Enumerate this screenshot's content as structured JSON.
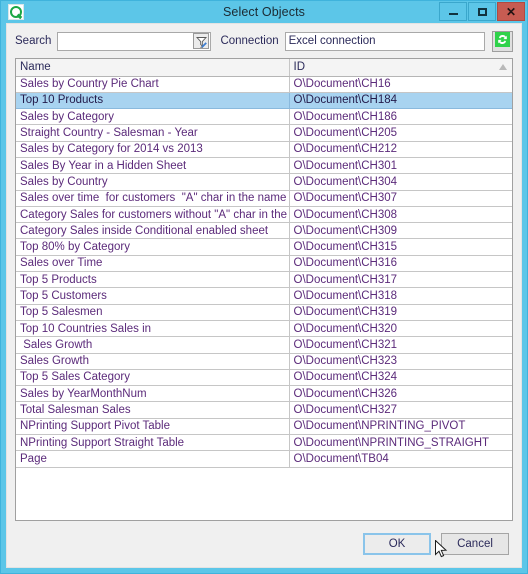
{
  "window": {
    "title": "Select Objects",
    "app_icon": "qlik-icon",
    "controls": {
      "minimize": "minimize-icon",
      "maximize": "maximize-icon",
      "close": "✕"
    }
  },
  "toolbar": {
    "search_label": "Search",
    "search_value": "",
    "search_placeholder": "",
    "filter_icon": "filter-pencil-icon",
    "connection_label": "Connection",
    "connection_value": "Excel connection",
    "refresh_icon": "refresh-icon"
  },
  "table": {
    "columns": [
      "Name",
      "ID"
    ],
    "sort_indicator": "ascending",
    "selected_row_index": 1,
    "rows": [
      {
        "name": "Sales by Country Pie Chart",
        "id": "O\\Document\\CH16"
      },
      {
        "name": "Top 10 Products",
        "id": "O\\Document\\CH184"
      },
      {
        "name": "Sales by Category",
        "id": "O\\Document\\CH186"
      },
      {
        "name": "Straight Country - Salesman - Year",
        "id": "O\\Document\\CH205"
      },
      {
        "name": "Sales by Category for 2014 vs 2013",
        "id": "O\\Document\\CH212"
      },
      {
        "name": "Sales By Year in a Hidden Sheet",
        "id": "O\\Document\\CH301"
      },
      {
        "name": "Sales by Country",
        "id": "O\\Document\\CH304"
      },
      {
        "name": "Sales over time  for customers  \"A\" char in the name",
        "id": "O\\Document\\CH307"
      },
      {
        "name": "Category Sales for customers without \"A\" char in the name",
        "id": "O\\Document\\CH308"
      },
      {
        "name": "Category Sales inside Conditional enabled sheet",
        "id": "O\\Document\\CH309"
      },
      {
        "name": "Top 80% by Category",
        "id": "O\\Document\\CH315"
      },
      {
        "name": "Sales over Time",
        "id": "O\\Document\\CH316"
      },
      {
        "name": "Top 5 Products",
        "id": "O\\Document\\CH317"
      },
      {
        "name": "Top 5 Customers",
        "id": "O\\Document\\CH318"
      },
      {
        "name": "Top 5 Salesmen",
        "id": "O\\Document\\CH319"
      },
      {
        "name": "Top 10 Countries Sales in",
        "id": "O\\Document\\CH320"
      },
      {
        "name": " Sales Growth",
        "id": "O\\Document\\CH321"
      },
      {
        "name": "Sales Growth",
        "id": "O\\Document\\CH323"
      },
      {
        "name": "Top 5 Sales Category",
        "id": "O\\Document\\CH324"
      },
      {
        "name": "Sales by YearMonthNum",
        "id": "O\\Document\\CH326"
      },
      {
        "name": "Total Salesman Sales",
        "id": "O\\Document\\CH327"
      },
      {
        "name": "NPrinting Support Pivot Table",
        "id": "O\\Document\\NPRINTING_PIVOT"
      },
      {
        "name": "NPrinting Support Straight Table",
        "id": "O\\Document\\NPRINTING_STRAIGHT"
      },
      {
        "name": "Page",
        "id": "O\\Document\\TB04"
      }
    ]
  },
  "footer": {
    "ok_label": "OK",
    "cancel_label": "Cancel"
  },
  "colors": {
    "titlebar": "#5cc6e8",
    "selection": "#a8d3f0",
    "close_button": "#c75c52",
    "accent_green": "#1aa745",
    "row_text": "#5b2a7a"
  }
}
